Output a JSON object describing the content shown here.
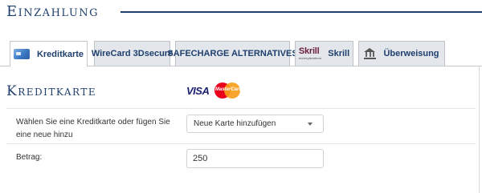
{
  "page": {
    "title": "Einzahlung"
  },
  "tabs": [
    {
      "label": "Kreditkarte",
      "icon": "credit-card-icon",
      "active": true
    },
    {
      "label": "WireCard 3Dsecure",
      "active": false
    },
    {
      "label": "SAFECHARGE ALTERNATIVES",
      "active": false
    },
    {
      "label": "Skrill",
      "icon": "skrill-logo",
      "logo_text": "Skrill",
      "logo_subtext": "moneybookers",
      "active": false
    },
    {
      "label": "Überweisung",
      "icon": "bank-icon",
      "active": false
    }
  ],
  "section": {
    "title": "Kreditkarte",
    "logos": {
      "visa": "VISA",
      "mastercard": "MasterCard"
    }
  },
  "form": {
    "card_label": "Wählen Sie eine Kreditkarte oder fügen Sie eine neue hinzu",
    "card_select_value": "Neue Karte hinzufügen",
    "amount_label": "Betrag:",
    "amount_value": "250"
  },
  "colors": {
    "accent": "#1f3f6e",
    "tab_inactive": "#e3e6ea",
    "border": "#c4c8cc"
  }
}
